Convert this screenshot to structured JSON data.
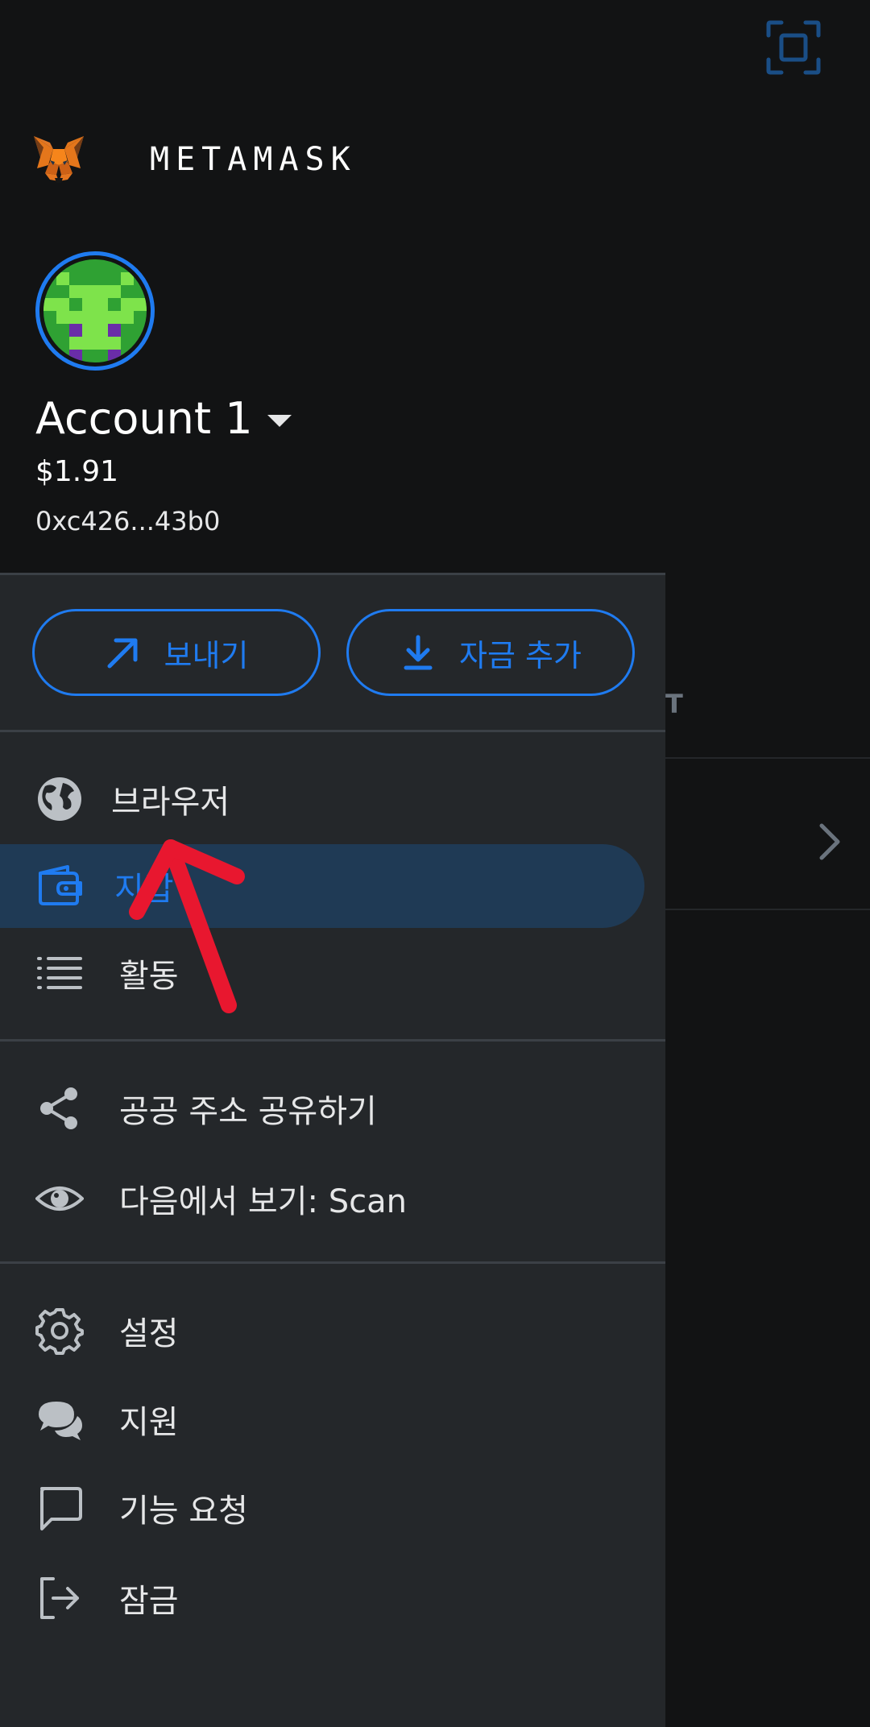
{
  "brand": {
    "name": "METAMASK"
  },
  "account": {
    "name": "Account 1",
    "balance": "$1.91",
    "address": "0xc426...43b0"
  },
  "actions": {
    "send_label": "보내기",
    "add_funds_label": "자금 추가"
  },
  "menu": {
    "browser": "브라우저",
    "wallet": "지갑",
    "activity": "활동",
    "share_address": "공공 주소 공유하기",
    "view_on": "다음에서 보기: Scan",
    "settings": "설정",
    "support": "지원",
    "feature_request": "기능 요청",
    "lock": "잠금"
  },
  "background": {
    "tab_fragment": "T"
  },
  "colors": {
    "accent": "#1f7bf0",
    "drawer_bg": "#24272a",
    "header_bg": "#121314",
    "active_bg": "#1f3a55",
    "annotation": "#e8172f"
  },
  "icons": [
    "scan-icon",
    "fox-logo-icon",
    "chevron-down-icon",
    "arrow-up-right-icon",
    "download-icon",
    "globe-icon",
    "wallet-icon",
    "list-icon",
    "share-icon",
    "eye-icon",
    "gear-icon",
    "chat-bubbles-icon",
    "message-square-icon",
    "logout-icon",
    "chevron-right-icon"
  ]
}
